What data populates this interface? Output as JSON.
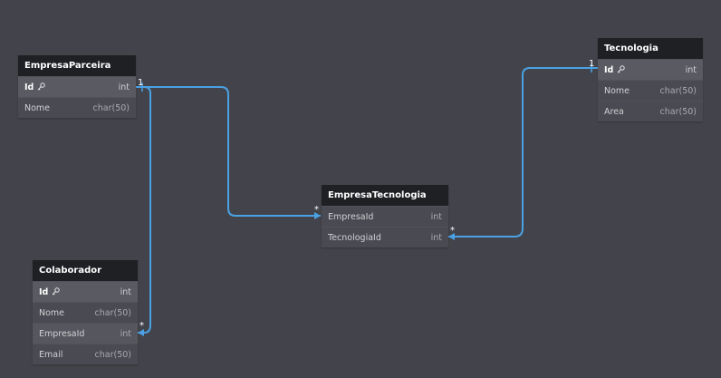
{
  "tables": {
    "empresa_parceira": {
      "name": "EmpresaParceira",
      "columns": [
        {
          "name": "Id",
          "type": "int",
          "pk": true
        },
        {
          "name": "Nome",
          "type": "char(50)"
        }
      ]
    },
    "tecnologia": {
      "name": "Tecnologia",
      "columns": [
        {
          "name": "Id",
          "type": "int",
          "pk": true
        },
        {
          "name": "Nome",
          "type": "char(50)"
        },
        {
          "name": "Area",
          "type": "char(50)"
        }
      ]
    },
    "empresa_tecnologia": {
      "name": "EmpresaTecnologia",
      "columns": [
        {
          "name": "EmpresaId",
          "type": "int"
        },
        {
          "name": "TecnologiaId",
          "type": "int"
        }
      ]
    },
    "colaborador": {
      "name": "Colaborador",
      "columns": [
        {
          "name": "Id",
          "type": "int",
          "pk": true
        },
        {
          "name": "Nome",
          "type": "char(50)"
        },
        {
          "name": "EmpresaId",
          "type": "int"
        },
        {
          "name": "Email",
          "type": "char(50)"
        }
      ]
    }
  },
  "relationships": {
    "one_label": "1",
    "many_label": "*",
    "line_color": "#4aa1e3"
  },
  "icons": {
    "primary_key": "key-icon"
  }
}
